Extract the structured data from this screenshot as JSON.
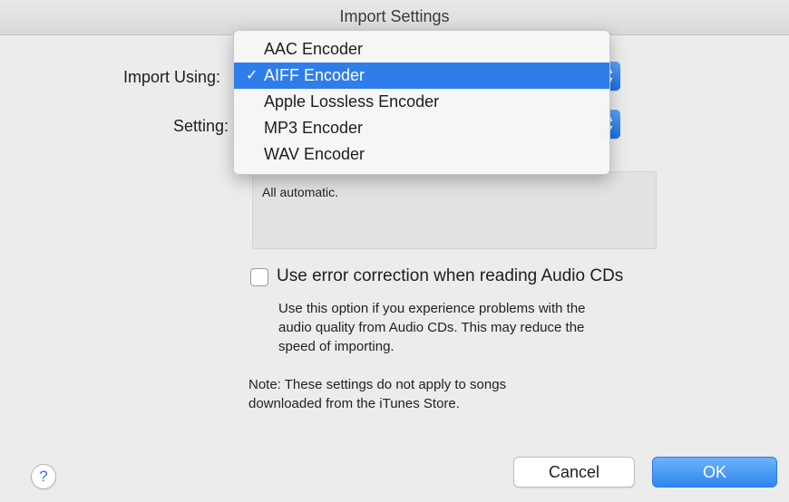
{
  "window": {
    "title": "Import Settings"
  },
  "form": {
    "import_using_label": "Import Using:",
    "setting_label": "Setting:",
    "description": "All automatic."
  },
  "error_correction": {
    "label": "Use error correction when reading Audio CDs",
    "checked": false,
    "help_lines": [
      "Use this option if you experience problems with the",
      "audio quality from Audio CDs.  This may reduce the",
      "speed of importing."
    ]
  },
  "note": {
    "lines": [
      "Note: These settings do not apply to songs",
      "downloaded from the iTunes Store."
    ]
  },
  "encoder_menu": {
    "items": [
      {
        "label": "AAC Encoder",
        "selected": false
      },
      {
        "label": "AIFF Encoder",
        "selected": true
      },
      {
        "label": "Apple Lossless Encoder",
        "selected": false
      },
      {
        "label": "MP3 Encoder",
        "selected": false
      },
      {
        "label": "WAV Encoder",
        "selected": false
      }
    ],
    "check_glyph": "✓"
  },
  "buttons": {
    "help": "?",
    "cancel": "Cancel",
    "ok": "OK"
  },
  "colors": {
    "accent": "#2f7de8",
    "window_bg": "#ececec"
  }
}
